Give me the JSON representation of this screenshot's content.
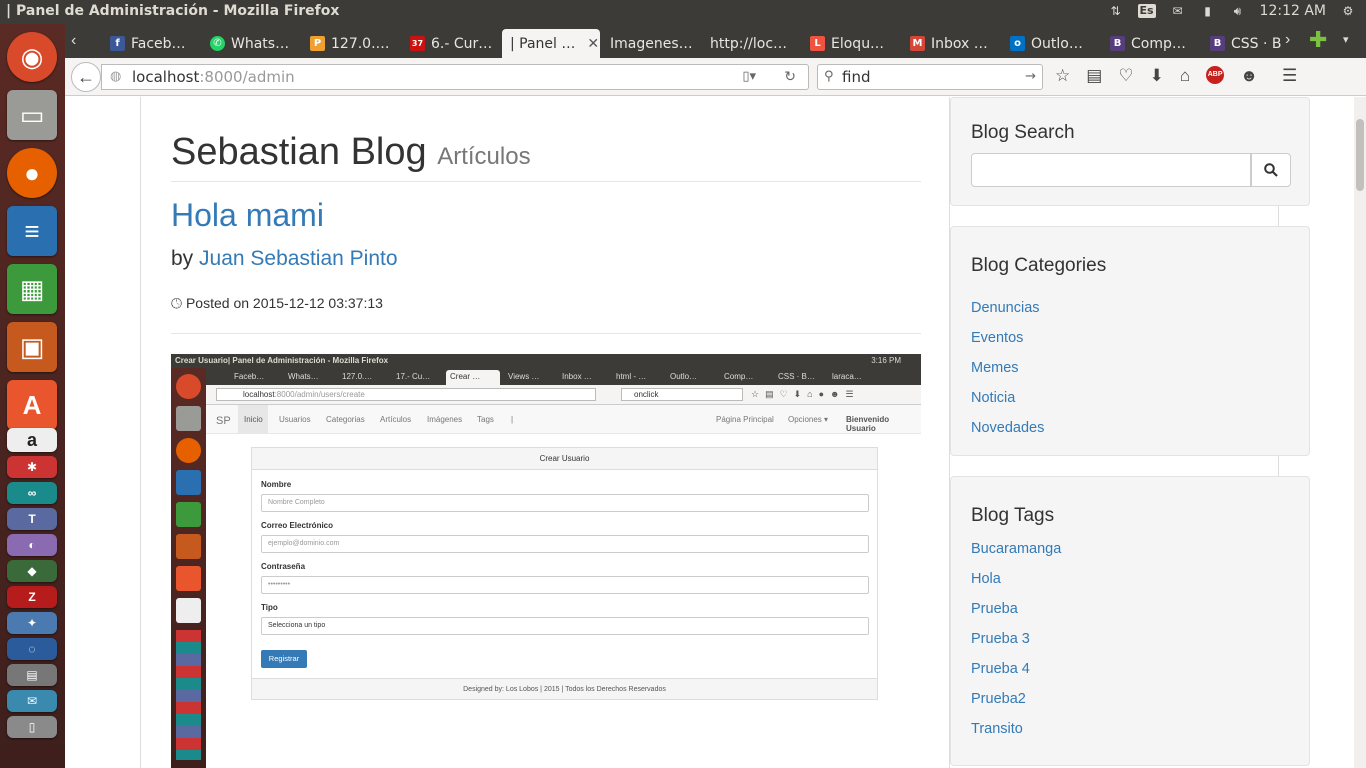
{
  "system": {
    "window_title": "| Panel de Administración - Mozilla Firefox",
    "keyboard_layout": "Es",
    "clock": "12:12 AM"
  },
  "tabs": [
    {
      "label": "Faceb…",
      "favicon_color": "#3b5998",
      "favicon_glyph": "f"
    },
    {
      "label": "Whats…",
      "favicon_color": "#25d366",
      "favicon_glyph": "✆"
    },
    {
      "label": "127.0.…",
      "favicon_color": "#f0a030",
      "favicon_glyph": "P"
    },
    {
      "label": "6.- Cur…",
      "favicon_color": "#cc1111",
      "favicon_glyph": "37"
    },
    {
      "label": "| Panel …",
      "favicon_color": "",
      "favicon_glyph": "",
      "active": true
    },
    {
      "label": "Imagenes…",
      "favicon_color": "",
      "favicon_glyph": ""
    },
    {
      "label": "http://loc…",
      "favicon_color": "",
      "favicon_glyph": ""
    },
    {
      "label": "Eloqu…",
      "favicon_color": "#f05340",
      "favicon_glyph": "L"
    },
    {
      "label": "Inbox …",
      "favicon_color": "#d44638",
      "favicon_glyph": "M"
    },
    {
      "label": "Outlo…",
      "favicon_color": "#0072c6",
      "favicon_glyph": "o"
    },
    {
      "label": "Comp…",
      "favicon_color": "#563d7c",
      "favicon_glyph": "B"
    },
    {
      "label": "CSS · B…",
      "favicon_color": "#563d7c",
      "favicon_glyph": "B"
    }
  ],
  "navigation": {
    "url_host": "localhost",
    "url_rest": ":8000/admin",
    "search_value": "find"
  },
  "blog": {
    "name": "Sebastian Blog",
    "section": "Artículos",
    "post_title": "Hola mami",
    "by_label": "by",
    "author": "Juan Sebastian Pinto",
    "posted_on": "Posted on 2015-12-12 03:37:13"
  },
  "embedded_screenshot": {
    "window_title": "Crear Usuario| Panel de Administración - Mozilla Firefox",
    "clock": "3:16 PM",
    "tabs": [
      "Faceb…",
      "Whats…",
      "127.0.…",
      "17.- Cu…",
      "Crear …",
      "Views …",
      "Inbox …",
      "html - …",
      "Outlo…",
      "Comp…",
      "CSS · B…",
      "laraca…"
    ],
    "url_host": "localhost",
    "url_rest": ":8000/admin/users/create",
    "search_value": "onclick",
    "brand": "SP",
    "menu": [
      "Inicio",
      "Usuarios",
      "Categorias",
      "Artículos",
      "Imágenes",
      "Tags",
      "|"
    ],
    "menu_right": [
      "Página Principal",
      "Opciones ▾",
      "Bienvenido Usuario"
    ],
    "panel_title": "Crear Usuario",
    "fields": [
      {
        "label": "Nombre",
        "placeholder": "Nombre Completo"
      },
      {
        "label": "Correo Electrónico",
        "placeholder": "ejemplo@dominio.com"
      },
      {
        "label": "Contraseña",
        "placeholder": "•••••••••"
      },
      {
        "label": "Tipo",
        "placeholder": "Selecciona un tipo"
      }
    ],
    "submit": "Registrar",
    "footer": "Designed by: Los Lobos | 2015 | Todos los Derechos Reservados"
  },
  "sidebar": {
    "search_title": "Blog Search",
    "categories_title": "Blog Categories",
    "categories": [
      "Denuncias",
      "Eventos",
      "Memes",
      "Noticia",
      "Novedades"
    ],
    "tags_title": "Blog Tags",
    "tags": [
      "Bucaramanga",
      "Hola",
      "Prueba",
      "Prueba 3",
      "Prueba 4",
      "Prueba2",
      "Transito"
    ]
  },
  "colors": {
    "link": "#337ab7",
    "ubuntu_panel": "#3c3b37"
  }
}
